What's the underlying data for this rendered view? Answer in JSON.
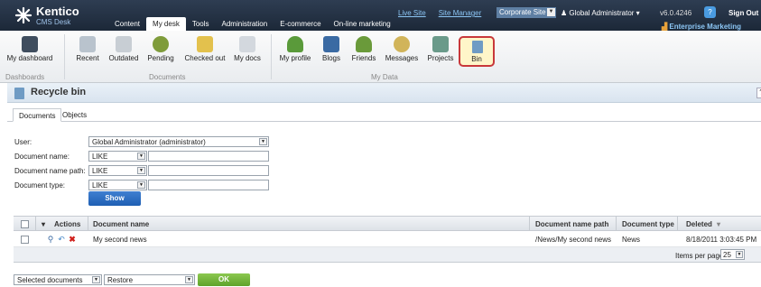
{
  "header": {
    "logo_name": "Kentico",
    "logo_sub": "CMS Desk",
    "main_tabs": [
      "Content",
      "My desk",
      "Tools",
      "Administration",
      "E-commerce",
      "On-line marketing"
    ],
    "active_tab": "My desk",
    "links": [
      "Live Site",
      "Site Manager"
    ],
    "site_select": "Corporate Site",
    "user": "Global Administrator",
    "version": "v6.0.4246",
    "help_icon": "?",
    "signout": "Sign Out",
    "enterprise": "Enterprise Marketing Solutio"
  },
  "ribbon": {
    "buttons": [
      {
        "label": "My dashboard",
        "icon": "dashboard-icon",
        "color": "#3f4d5e"
      },
      {
        "label": "Recent",
        "icon": "recent-icon",
        "color": "#b9c3cd"
      },
      {
        "label": "Outdated",
        "icon": "outdated-icon",
        "color": "#c8ced4"
      },
      {
        "label": "Pending",
        "icon": "pending-icon",
        "color": "#7f9c3b"
      },
      {
        "label": "Checked out",
        "icon": "checked-out-icon",
        "color": "#e3c14d"
      },
      {
        "label": "My docs",
        "icon": "my-docs-icon",
        "color": "#d3d8de"
      },
      {
        "label": "My profile",
        "icon": "profile-icon",
        "color": "#5a9a3a"
      },
      {
        "label": "Blogs",
        "icon": "blogs-icon",
        "color": "#3a6aa3"
      },
      {
        "label": "Friends",
        "icon": "friends-icon",
        "color": "#6a9a3a"
      },
      {
        "label": "Messages",
        "icon": "messages-icon",
        "color": "#d1b45a"
      },
      {
        "label": "Projects",
        "icon": "projects-icon",
        "color": "#6a9a8a"
      },
      {
        "label": "Bin",
        "icon": "bin-icon",
        "color": "#6f9bc4"
      }
    ],
    "groups": [
      "Dashboards",
      "Documents",
      "My Data"
    ]
  },
  "page": {
    "title": "Recycle bin",
    "help": "?",
    "tabs": [
      "Documents",
      "Objects"
    ]
  },
  "filter": {
    "user_label": "User:",
    "user_value": "Global Administrator (administrator)",
    "name_label": "Document name:",
    "name_op": "LIKE",
    "name_value": "",
    "path_label": "Document name path:",
    "path_op": "LIKE",
    "path_value": "",
    "type_label": "Document type:",
    "type_op": "LIKE",
    "type_value": "",
    "show_button": "Show"
  },
  "grid": {
    "columns": [
      "Actions",
      "Document name",
      "Document name path",
      "Document type",
      "Deleted"
    ],
    "sort_indicator": "▾",
    "rows": [
      {
        "name": "My second news",
        "path": "/News/My second news",
        "type": "News",
        "deleted": "8/18/2011 3:03:45 PM"
      }
    ],
    "items_per_page_label": "Items per page:",
    "items_per_page": "25"
  },
  "bulk": {
    "scope": "Selected documents",
    "action": "Restore",
    "ok": "OK"
  }
}
